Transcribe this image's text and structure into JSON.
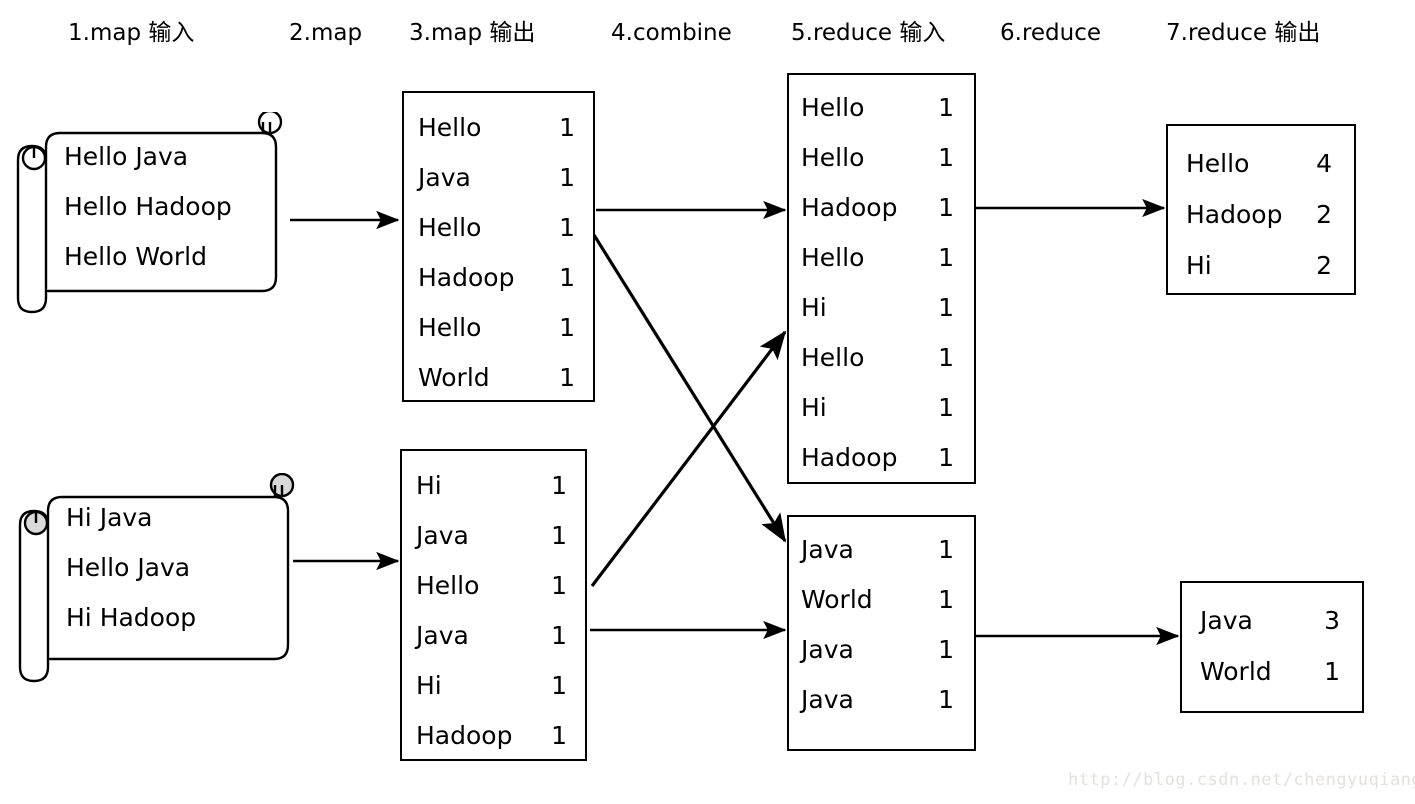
{
  "diagram": {
    "title_watermark": "http://blog.csdn.net/chengyuqiang",
    "phases": [
      {
        "id": "map-input",
        "label": "1.map 输入"
      },
      {
        "id": "map",
        "label": "2.map"
      },
      {
        "id": "map-output",
        "label": "3.map 输出"
      },
      {
        "id": "combine",
        "label": "4.combine"
      },
      {
        "id": "reduce-input",
        "label": "5.reduce 输入"
      },
      {
        "id": "reduce",
        "label": "6.reduce"
      },
      {
        "id": "reduce-output",
        "label": "7.reduce 输出"
      }
    ],
    "map_inputs": [
      {
        "id": "split-1",
        "curl_fill": "#ffffff",
        "lines": [
          "Hello Java",
          "Hello Hadoop",
          "Hello World"
        ]
      },
      {
        "id": "split-2",
        "curl_fill": "#d9d9d9",
        "lines": [
          "Hi Java",
          "Hello Java",
          "Hi Hadoop"
        ]
      }
    ],
    "map_outputs": [
      {
        "id": "map-output-1",
        "rows": [
          {
            "key": "Hello",
            "value": "1"
          },
          {
            "key": "Java",
            "value": "1"
          },
          {
            "key": "Hello",
            "value": "1"
          },
          {
            "key": "Hadoop",
            "value": "1"
          },
          {
            "key": "Hello",
            "value": "1"
          },
          {
            "key": "World",
            "value": "1"
          }
        ]
      },
      {
        "id": "map-output-2",
        "rows": [
          {
            "key": "Hi",
            "value": "1"
          },
          {
            "key": "Java",
            "value": "1"
          },
          {
            "key": "Hello",
            "value": "1"
          },
          {
            "key": "Java",
            "value": "1"
          },
          {
            "key": "Hi",
            "value": "1"
          },
          {
            "key": "Hadoop",
            "value": "1"
          }
        ]
      }
    ],
    "reduce_inputs": [
      {
        "id": "reduce-input-1",
        "rows": [
          {
            "key": "Hello",
            "value": "1"
          },
          {
            "key": "Hello",
            "value": "1"
          },
          {
            "key": "Hadoop",
            "value": "1"
          },
          {
            "key": "Hello",
            "value": "1"
          },
          {
            "key": "Hi",
            "value": "1"
          },
          {
            "key": "Hello",
            "value": "1"
          },
          {
            "key": "Hi",
            "value": "1"
          },
          {
            "key": "Hadoop",
            "value": "1"
          }
        ]
      },
      {
        "id": "reduce-input-2",
        "rows": [
          {
            "key": "Java",
            "value": "1"
          },
          {
            "key": "World",
            "value": "1"
          },
          {
            "key": "Java",
            "value": "1"
          },
          {
            "key": "Java",
            "value": "1"
          }
        ]
      }
    ],
    "reduce_outputs": [
      {
        "id": "reduce-output-1",
        "rows": [
          {
            "key": "Hello",
            "value": "4"
          },
          {
            "key": "Hadoop",
            "value": "2"
          },
          {
            "key": "Hi",
            "value": "2"
          }
        ]
      },
      {
        "id": "reduce-output-2",
        "rows": [
          {
            "key": "Java",
            "value": "3"
          },
          {
            "key": "World",
            "value": "1"
          }
        ]
      }
    ],
    "connections": [
      {
        "id": "split1-to-mapout1",
        "from": "split-1",
        "to": "map-output-1"
      },
      {
        "id": "split2-to-mapout2",
        "from": "split-2",
        "to": "map-output-2"
      },
      {
        "id": "mapout1-to-redin1",
        "from": "map-output-1",
        "to": "reduce-input-1"
      },
      {
        "id": "mapout1-to-redin2",
        "from": "map-output-1",
        "to": "reduce-input-2"
      },
      {
        "id": "mapout2-to-redin1",
        "from": "map-output-2",
        "to": "reduce-input-1"
      },
      {
        "id": "mapout2-to-redin2",
        "from": "map-output-2",
        "to": "reduce-input-2"
      },
      {
        "id": "redin1-to-redout1",
        "from": "reduce-input-1",
        "to": "reduce-output-1"
      },
      {
        "id": "redin2-to-redout2",
        "from": "reduce-input-2",
        "to": "reduce-output-2"
      }
    ],
    "colors": {
      "stroke": "#000000",
      "background": "#ffffff",
      "curl_shaded": "#d9d9d9",
      "watermark": "#e3e1dd"
    }
  }
}
